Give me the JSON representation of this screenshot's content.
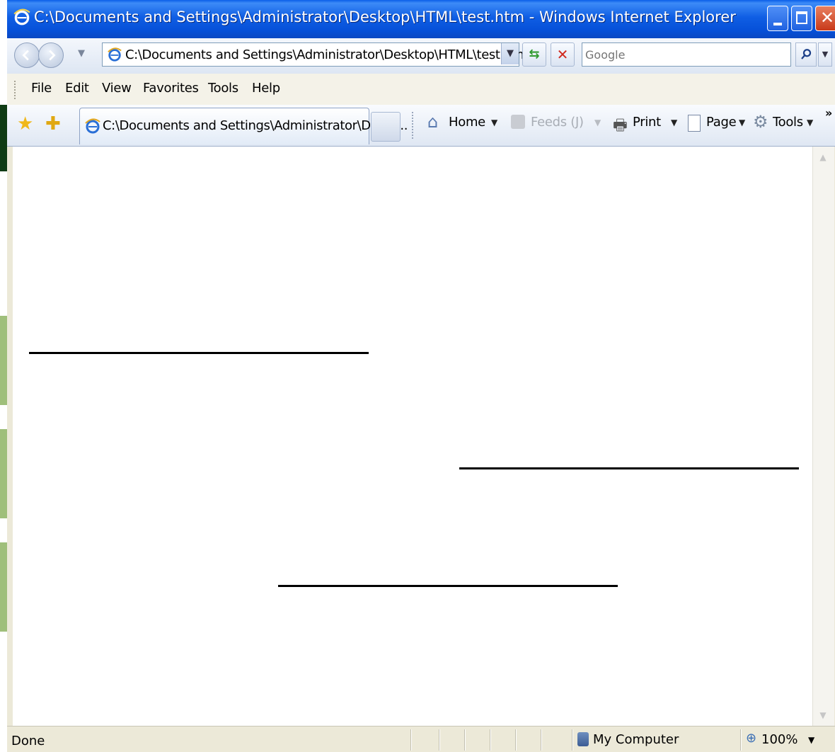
{
  "window": {
    "title": "C:\\Documents and Settings\\Administrator\\Desktop\\HTML\\test.htm - Windows Internet Explorer"
  },
  "address_bar": {
    "url": "C:\\Documents and Settings\\Administrator\\Desktop\\HTML\\test.htm",
    "search_placeholder": "Google"
  },
  "menu": {
    "items": [
      "File",
      "Edit",
      "View",
      "Favorites",
      "Tools",
      "Help"
    ]
  },
  "tabs": [
    {
      "label": "C:\\Documents and Settings\\Administrator\\Deskt..."
    }
  ],
  "command_bar": {
    "home": "Home",
    "feeds": "Feeds (J)",
    "print": "Print",
    "page": "Page",
    "tools": "Tools"
  },
  "status_bar": {
    "status": "Done",
    "zone": "My Computer",
    "zoom": "100%"
  },
  "icons": {
    "ie_logo": "ie-logo-icon",
    "back": "back-arrow-icon",
    "forward": "forward-arrow-icon",
    "refresh": "refresh-icon",
    "stop": "stop-icon",
    "search": "magnifier-icon",
    "favorites": "star-icon",
    "add_favorites": "add-favorite-icon",
    "home": "house-icon",
    "feeds": "rss-icon",
    "print": "printer-icon",
    "page": "page-icon",
    "tools": "gear-icon",
    "zone": "computer-icon",
    "zoom": "zoom-icon"
  },
  "colors": {
    "titlebar": "#0a55df",
    "content_background": "#ffffff",
    "rule_color": "#000000"
  }
}
